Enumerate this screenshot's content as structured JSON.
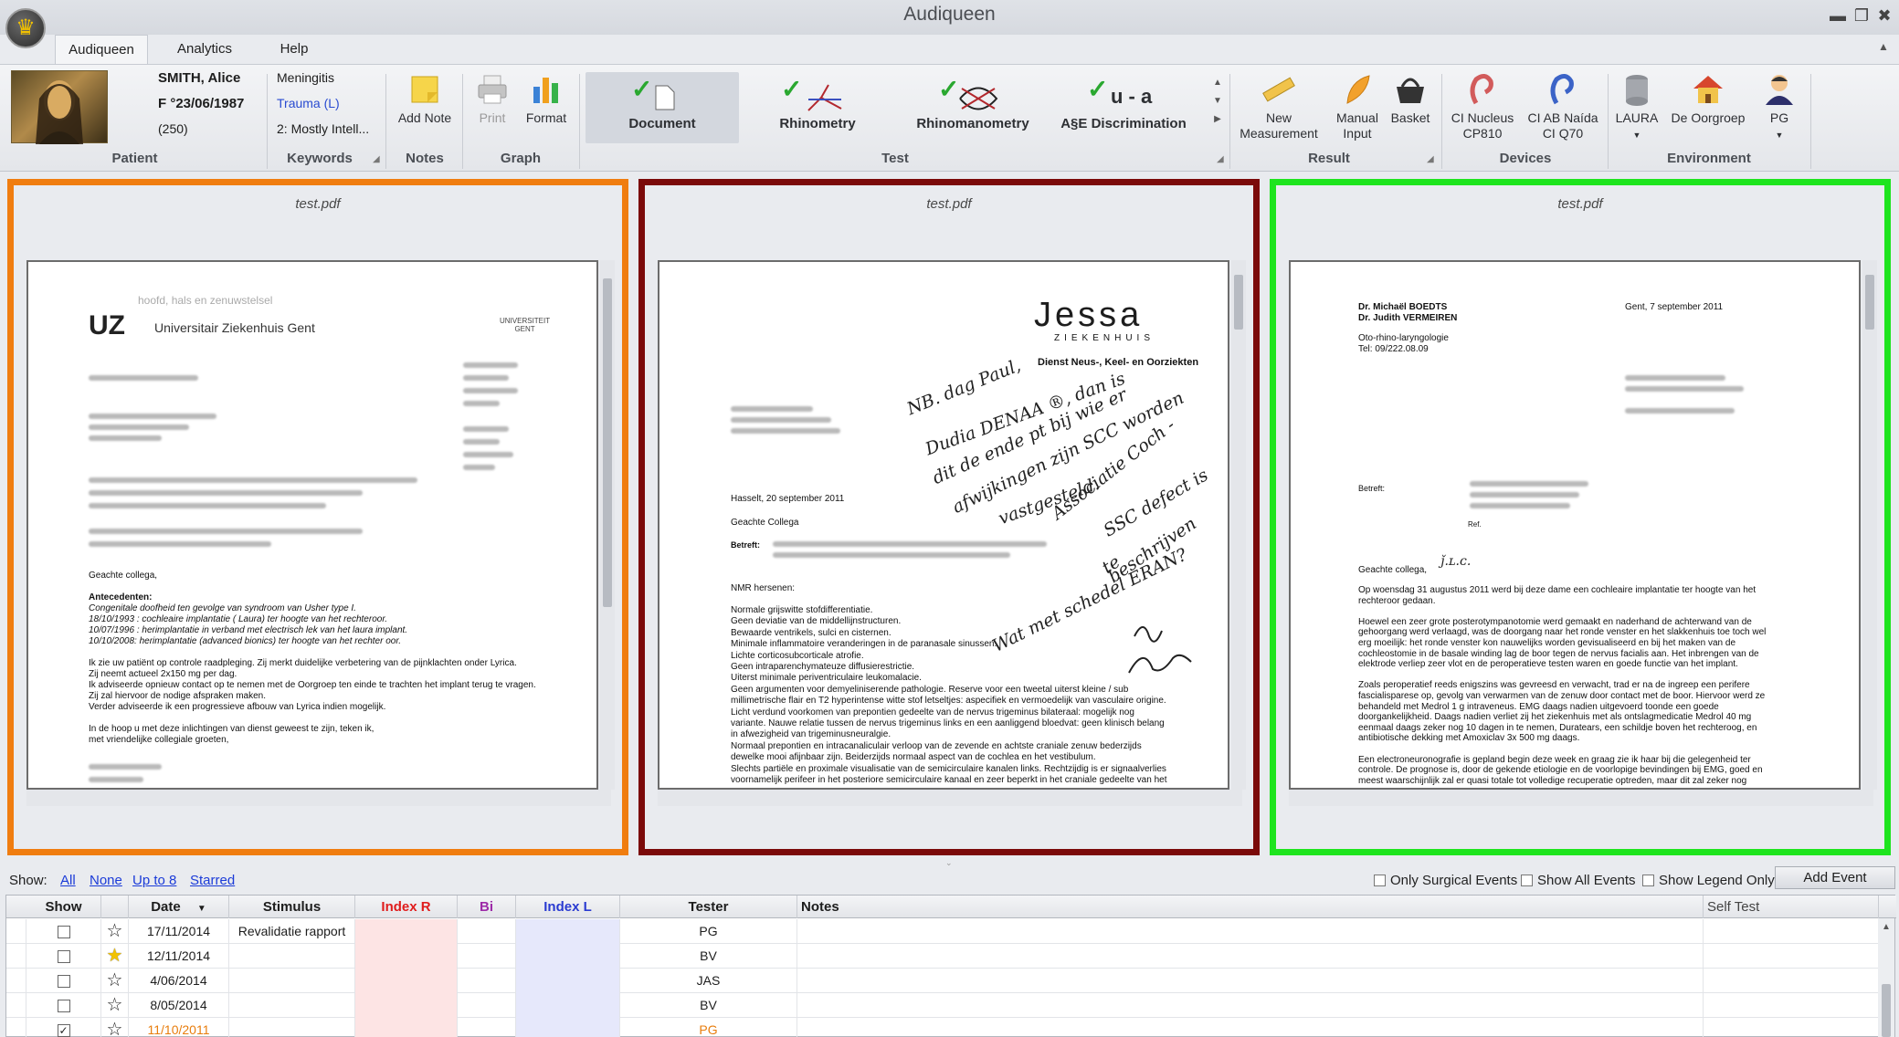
{
  "app": {
    "title": "Audiqueen",
    "logo_icon": "crown-icon"
  },
  "window": {
    "minimize": "▬",
    "restore": "❐",
    "close": "✖",
    "collapse": "▲"
  },
  "menu": {
    "tabs": [
      "Audiqueen",
      "Analytics",
      "Help"
    ]
  },
  "patient": {
    "name": "SMITH, Alice",
    "info": "F °23/06/1987",
    "code": "(250)",
    "label": "Patient"
  },
  "keywords": {
    "items": [
      "Meningitis",
      "Trauma (L)",
      "2: Mostly Intell..."
    ],
    "label": "Keywords"
  },
  "notes": {
    "add": "Add Note",
    "label": "Notes"
  },
  "graph": {
    "print": "Print",
    "format": "Format",
    "label": "Graph"
  },
  "test": {
    "items": [
      "Document",
      "Rhinometry",
      "Rhinomanometry",
      "A§E Discrimination"
    ],
    "ae_glyph": "u - a",
    "label": "Test"
  },
  "result": {
    "new_measurement": "New\nMeasurement",
    "manual_input": "Manual\nInput",
    "basket": "Basket",
    "label": "Result"
  },
  "devices": {
    "items": [
      "CI Nucleus\nCP810",
      "CI AB Naída\nCI Q70"
    ],
    "label": "Devices"
  },
  "environment": {
    "items": [
      "LAURA",
      "De Oorgroep",
      "PG"
    ],
    "label": "Environment"
  },
  "panes": [
    {
      "title": "test.pdf",
      "border": "#f07d10"
    },
    {
      "title": "test.pdf",
      "border": "#7b0a0a"
    },
    {
      "title": "test.pdf",
      "border": "#1ee41e"
    }
  ],
  "doc1": {
    "tagline": "hoofd, hals en zenuwstelsel",
    "logo": "UZ",
    "hospital": "Universitair Ziekenhuis Gent",
    "univ": "UNIVERSITEIT\nGENT",
    "greeting": "Geachte collega,",
    "antecedenten": "Antecedenten:",
    "history": [
      "Congenitale doofheid ten gevolge van syndroom van Usher type I.",
      "18/10/1993 : cochleaire implantatie ( Laura) ter hoogte van het rechteroor.",
      "10/07/1996 : herimplantatie in verband met electrisch lek van het laura implant.",
      "10/10/2008: herimplantatie  (advanced bionics) ter hoogte van het rechter oor."
    ],
    "body": [
      "Ik zie uw patiënt op controle raadpleging. Zij merkt duidelijke verbetering van de pijnklachten onder Lyrica.",
      "Zij neemt actueel 2x150 mg per dag.",
      "Ik adviseerde opnieuw contact op te nemen met de Oorgroep ten einde te trachten het implant terug te vragen.",
      "Zij zal hiervoor de nodige afspraken maken.",
      "Verder adviseerde ik een progressieve afbouw van Lyrica indien mogelijk.",
      "",
      "In de hoop u met deze inlichtingen van dienst geweest te zijn, teken ik,",
      "met vriendelijke collegiale groeten,"
    ]
  },
  "doc2": {
    "logo": "Jessa",
    "logo_sub": "ZIEKENHUIS",
    "dept": "Dienst Neus-, Keel- en Oorziekten",
    "date": "Hasselt, 20 september 2011",
    "greeting": "Geachte Collega",
    "betreft": "Betreft:",
    "nmr": "NMR hersenen:",
    "body": [
      "Normale grijswitte stofdifferentiatie.",
      "Geen deviatie van de middellijnstructuren.",
      "Bewaarde ventrikels, sulci en cisternen.",
      "Minimale inflammatoire veranderingen in de paranasale sinussen.",
      "Lichte corticosubcorticale atrofie.",
      "Geen intraparenchymateuze diffusierestrictie.",
      "Uiterst minimale periventriculaire leukomalacie.",
      "Geen argumenten voor demyeliniserende pathologie. Reserve voor een tweetal uiterst kleine / sub",
      "millimetrische flair en T2 hyperintense witte stof letseltjes: aspecifiek en vermoedelijk van vasculaire origine.",
      "Licht verdund voorkomen van prepontien gedeelte van de nervus trigeminus bilateraal: mogelijk nog",
      "variante. Nauwe relatie tussen de nervus trigeminus links en een aanliggend bloedvat: geen klinisch belang",
      "in afwezigheid van trigeminusneuralgie.",
      "Normaal prepontien en intracanaliculair verloop van de zevende en achtste craniale zenuw bederzijds",
      "dewelke mooi afijnbaar zijn. Beiderzijds normaal aspect van de cochlea en het vestibulum.",
      "Slechts partiële en proximale visualisatie van de semicirculaire kanalen links. Rechtzijdig is er signaalverlies",
      "voornamelijk perifeer in het posteriore semicirculaire kanaal en zeer beperkt in het craniale gedeelte van het"
    ],
    "handwriting": [
      "NB. dag Paul,",
      "Dudia DENAA ®, dan is",
      "dit de ende pt bij wie er",
      "afwijkingen zijn SCC worden",
      "vastgesteld.",
      "Associatie Coch -",
      "SSC defect is",
      "te beschrijven",
      "Wat met schedel ERAN?"
    ]
  },
  "doc3": {
    "doctors": [
      "Dr. Michaël BOEDTS",
      "Dr. Judith VERMEIREN"
    ],
    "dept": "Oto-rhino-laryngologie",
    "tel": "Tel: 09/222.08.09",
    "date": "Gent, 7 september 2011",
    "betreft": "Betreft:",
    "ref": "Ref.",
    "greeting": "Geachte collega,",
    "body": [
      "Op woensdag 31 augustus 2011 werd bij deze dame een cochleaire implantatie ter hoogte van het",
      "rechteroor gedaan.",
      "",
      "Hoewel een zeer grote posterotympanotomie werd gemaakt en naderhand de achterwand van de",
      "gehoorgang werd verlaagd, was de doorgang naar het ronde venster en het slakkenhuis toe toch wel",
      "erg moeilijk: het ronde venster kon nauwelijks worden gevisualiseerd en bij het maken van de",
      "cochleostomie in de basale winding lag de boor tegen de nervus facialis aan. Het inbrengen van de",
      "elektrode verliep zeer vlot en de peroperatieve testen waren en goede functie van het implant.",
      "",
      "Zoals peroperatief reeds enigszins was gevreesd en verwacht, trad er na de ingreep een perifere",
      "fascialisparese op, gevolg van verwarmen van de zenuw door contact met de boor. Hiervoor werd ze",
      "behandeld met Medrol 1 g intraveneus. EMG daags nadien uitgevoerd toonde een goede",
      "doorgankelijkheid. Daags nadien verliet zij het ziekenhuis met als ontslagmedicatie Medrol 40 mg",
      "eenmaal daags zeker nog 10 dagen in te nemen, Duratears, een schildje boven het rechteroog, en",
      "antibiotische dekking met Amoxiclav 3x 500 mg daags.",
      "",
      "Een electroneuronografie is gepland begin deze week en graag zie ik haar bij die gelegenheid ter",
      "controle. De prognose is, door de gekende etiologie en de voorlopige bevindingen bij EMG, goed en",
      "meest waarschijnlijk zal er quasi totale tot volledige recuperatie optreden, maar dit zal zeker nog"
    ]
  },
  "filters": {
    "show_label": "Show:",
    "links": [
      "All",
      "None",
      "Up to 8",
      "Starred"
    ],
    "checks": [
      "Only Surgical Events",
      "Show All Events",
      "Show Legend Only"
    ],
    "add_event": "Add Event"
  },
  "grid": {
    "headers": [
      "Show",
      "",
      "Date",
      "Stimulus",
      "Index R",
      "Bi",
      "Index L",
      "Tester",
      "Notes",
      "Self Test"
    ],
    "sort_icon": "▼",
    "rows": [
      {
        "show": false,
        "starred": false,
        "date": "17/11/2014",
        "stimulus": "Revalidatie rapport",
        "tester": "PG"
      },
      {
        "show": false,
        "starred": true,
        "date": "12/11/2014",
        "stimulus": "",
        "tester": "BV"
      },
      {
        "show": false,
        "starred": false,
        "date": "4/06/2014",
        "stimulus": "",
        "tester": "JAS"
      },
      {
        "show": false,
        "starred": false,
        "date": "8/05/2014",
        "stimulus": "",
        "tester": "BV"
      },
      {
        "show": true,
        "starred": false,
        "date": "11/10/2011",
        "stimulus": "",
        "tester": "PG",
        "highlight": "#e87d0d"
      }
    ]
  }
}
